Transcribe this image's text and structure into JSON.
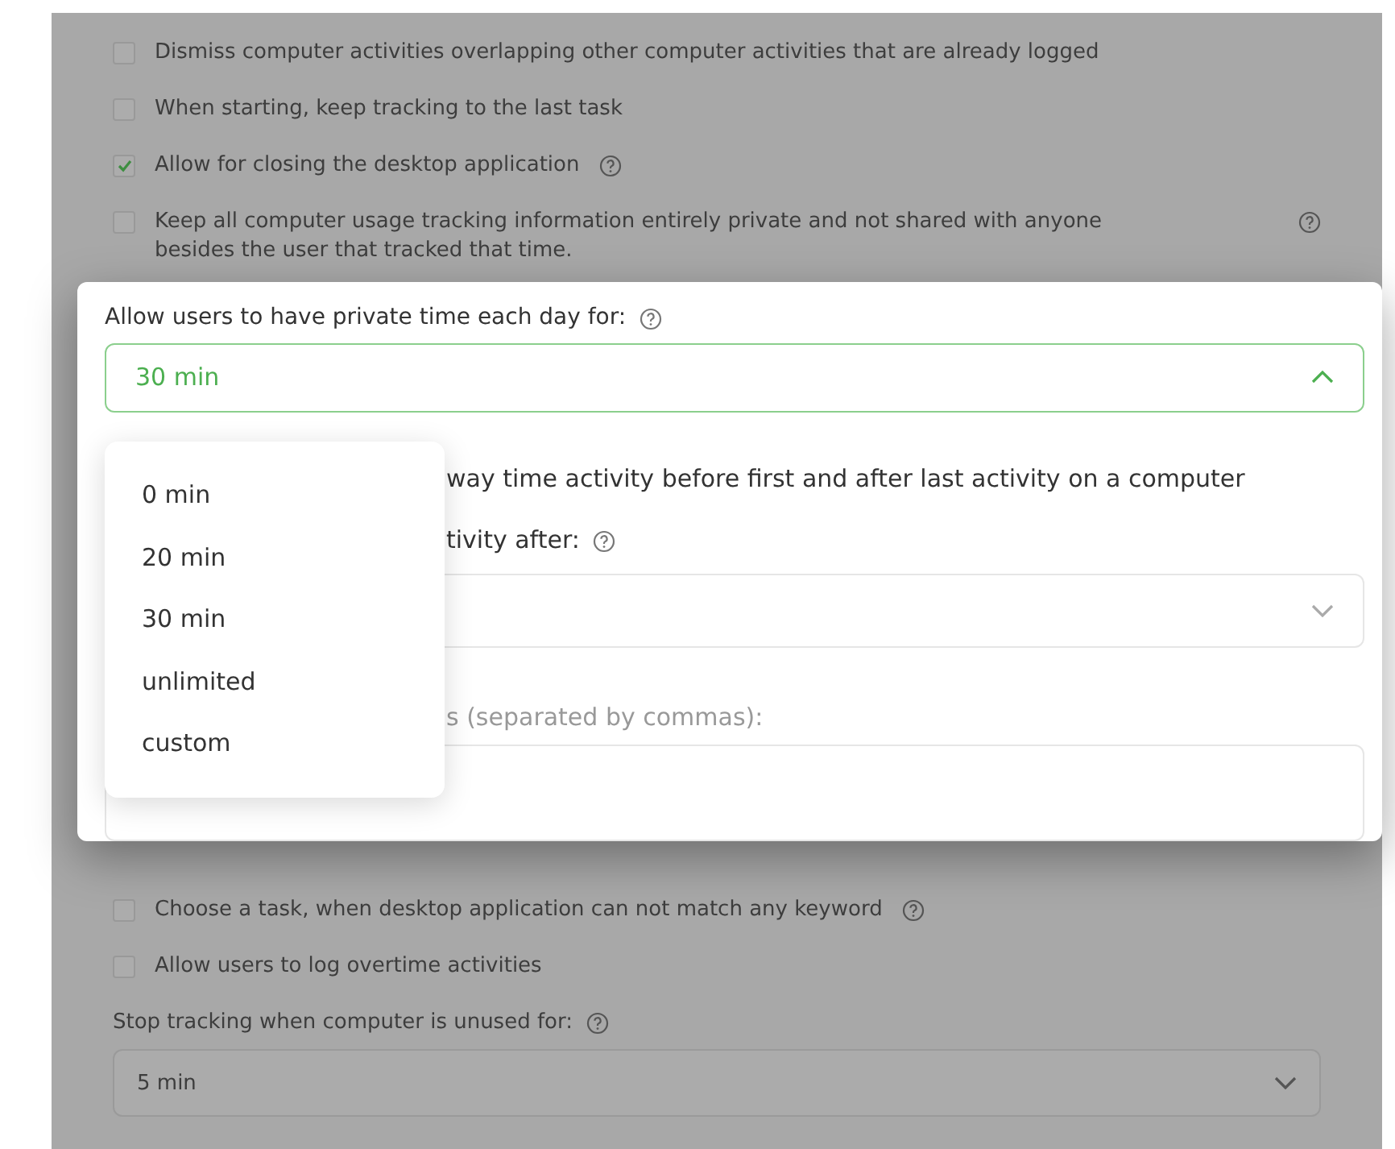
{
  "background_options": [
    {
      "label": "Dismiss computer activities overlapping other computer activities that are already logged",
      "checked": false,
      "has_help": false
    },
    {
      "label": "When starting, keep tracking to the last task",
      "checked": false,
      "has_help": false
    },
    {
      "label": "Allow for closing the desktop application",
      "checked": true,
      "has_help": true
    },
    {
      "label": "Keep all computer usage tracking information entirely private and not shared with anyone besides the user that tracked that time.",
      "checked": false,
      "has_help": true,
      "help_at_end": true
    }
  ],
  "private_time": {
    "label": "Allow users to have private time each day for:",
    "value": "30 min",
    "expanded": true,
    "options": [
      "0 min",
      "20 min",
      "30 min",
      "unlimited",
      "custom"
    ]
  },
  "hidden_row": {
    "text": "way time activity before first and after last activity on a computer"
  },
  "hidden_label": {
    "text": "tivity after:"
  },
  "hidden_field_label": {
    "text": "s (separated by commas):"
  },
  "lower_options": [
    {
      "label": "Choose a task, when desktop application can not match any keyword",
      "checked": false,
      "has_help": true
    },
    {
      "label": "Allow users to log overtime activities",
      "checked": false,
      "has_help": false
    }
  ],
  "unused": {
    "label": "Stop tracking when computer is unused for:",
    "value": "5 min"
  }
}
